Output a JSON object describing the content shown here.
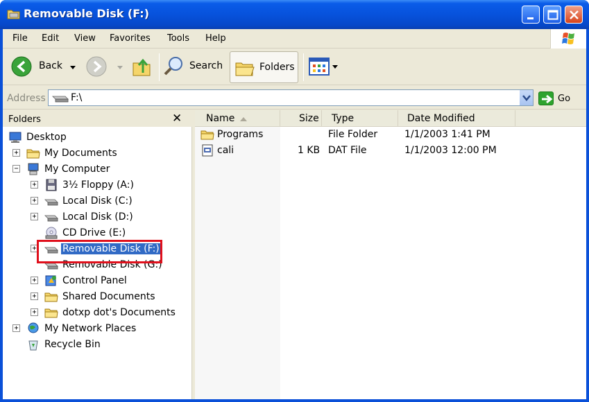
{
  "window": {
    "title": "Removable Disk (F:)",
    "controls": {
      "minimize": "minimize-icon",
      "maximize": "maximize-icon",
      "close": "close-icon"
    }
  },
  "menu": {
    "items": [
      "File",
      "Edit",
      "View",
      "Favorites",
      "Tools",
      "Help"
    ]
  },
  "toolbar": {
    "back_label": "Back",
    "search_label": "Search",
    "folders_label": "Folders"
  },
  "address": {
    "label": "Address",
    "value": "F:\\",
    "go_label": "Go"
  },
  "folders_pane": {
    "title": "Folders",
    "close_glyph": "✕",
    "tree": [
      {
        "label": "Desktop",
        "icon": "desktop-icon",
        "level": 0,
        "expander": ""
      },
      {
        "label": "My Documents",
        "icon": "folder-icon",
        "level": 1,
        "expander": "+"
      },
      {
        "label": "My Computer",
        "icon": "computer-icon",
        "level": 1,
        "expander": "−"
      },
      {
        "label": "3½ Floppy (A:)",
        "icon": "floppy-icon",
        "level": 2,
        "expander": "+"
      },
      {
        "label": "Local Disk (C:)",
        "icon": "drive-icon",
        "level": 2,
        "expander": "+"
      },
      {
        "label": "Local Disk (D:)",
        "icon": "drive-icon",
        "level": 2,
        "expander": "+"
      },
      {
        "label": "CD Drive (E:)",
        "icon": "cd-icon",
        "level": 2,
        "expander": ""
      },
      {
        "label": "Removable Disk (F:)",
        "icon": "drive-icon",
        "level": 2,
        "expander": "+",
        "selected": true
      },
      {
        "label": "Removable Disk (G:)",
        "icon": "drive-icon",
        "level": 2,
        "expander": ""
      },
      {
        "label": "Control Panel",
        "icon": "control-panel-icon",
        "level": 2,
        "expander": "+"
      },
      {
        "label": "Shared Documents",
        "icon": "folder-icon",
        "level": 2,
        "expander": "+"
      },
      {
        "label": "dotxp dot's Documents",
        "icon": "folder-icon",
        "level": 2,
        "expander": "+"
      },
      {
        "label": "My Network Places",
        "icon": "network-icon",
        "level": 1,
        "expander": "+"
      },
      {
        "label": "Recycle Bin",
        "icon": "recycle-bin-icon",
        "level": 1,
        "expander": ""
      }
    ]
  },
  "file_list": {
    "columns": [
      "Name",
      "Size",
      "Type",
      "Date Modified"
    ],
    "rows": [
      {
        "name": "Programs",
        "size": "",
        "type": "File Folder",
        "date": "1/1/2003 1:41 PM",
        "icon": "folder-icon"
      },
      {
        "name": "cali",
        "size": "1 KB",
        "type": "DAT File",
        "date": "1/1/2003 12:00 PM",
        "icon": "dat-file-icon"
      }
    ]
  },
  "colors": {
    "titlebar": "#0752dc",
    "selection": "#316ac5",
    "highlight_box": "#e0101c"
  }
}
